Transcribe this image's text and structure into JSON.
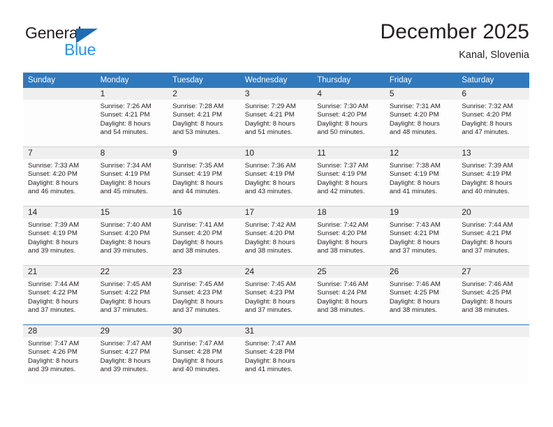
{
  "brand": {
    "name_part1": "General",
    "name_part2": "Blue",
    "triangle_color": "#1f6cb4",
    "blue_color": "#2196f3"
  },
  "header": {
    "month_title": "December 2025",
    "location": "Kanal, Slovenia"
  },
  "theme": {
    "header_row_color": "#3079bc",
    "daynum_band_color": "#efefef",
    "grid_line_color": "#cfcfcf",
    "accent_rule_color": "#2f78bb",
    "text_color": "#231f20"
  },
  "weekdays": [
    "Sunday",
    "Monday",
    "Tuesday",
    "Wednesday",
    "Thursday",
    "Friday",
    "Saturday"
  ],
  "weeks": [
    [
      {
        "day": "",
        "sunrise": "",
        "sunset": "",
        "daylight_line1": "",
        "daylight_line2": "",
        "empty": true
      },
      {
        "day": "1",
        "sunrise": "Sunrise: 7:26 AM",
        "sunset": "Sunset: 4:21 PM",
        "daylight_line1": "Daylight: 8 hours",
        "daylight_line2": "and 54 minutes."
      },
      {
        "day": "2",
        "sunrise": "Sunrise: 7:28 AM",
        "sunset": "Sunset: 4:21 PM",
        "daylight_line1": "Daylight: 8 hours",
        "daylight_line2": "and 53 minutes."
      },
      {
        "day": "3",
        "sunrise": "Sunrise: 7:29 AM",
        "sunset": "Sunset: 4:21 PM",
        "daylight_line1": "Daylight: 8 hours",
        "daylight_line2": "and 51 minutes."
      },
      {
        "day": "4",
        "sunrise": "Sunrise: 7:30 AM",
        "sunset": "Sunset: 4:20 PM",
        "daylight_line1": "Daylight: 8 hours",
        "daylight_line2": "and 50 minutes."
      },
      {
        "day": "5",
        "sunrise": "Sunrise: 7:31 AM",
        "sunset": "Sunset: 4:20 PM",
        "daylight_line1": "Daylight: 8 hours",
        "daylight_line2": "and 48 minutes."
      },
      {
        "day": "6",
        "sunrise": "Sunrise: 7:32 AM",
        "sunset": "Sunset: 4:20 PM",
        "daylight_line1": "Daylight: 8 hours",
        "daylight_line2": "and 47 minutes."
      }
    ],
    [
      {
        "day": "7",
        "sunrise": "Sunrise: 7:33 AM",
        "sunset": "Sunset: 4:20 PM",
        "daylight_line1": "Daylight: 8 hours",
        "daylight_line2": "and 46 minutes."
      },
      {
        "day": "8",
        "sunrise": "Sunrise: 7:34 AM",
        "sunset": "Sunset: 4:19 PM",
        "daylight_line1": "Daylight: 8 hours",
        "daylight_line2": "and 45 minutes."
      },
      {
        "day": "9",
        "sunrise": "Sunrise: 7:35 AM",
        "sunset": "Sunset: 4:19 PM",
        "daylight_line1": "Daylight: 8 hours",
        "daylight_line2": "and 44 minutes."
      },
      {
        "day": "10",
        "sunrise": "Sunrise: 7:36 AM",
        "sunset": "Sunset: 4:19 PM",
        "daylight_line1": "Daylight: 8 hours",
        "daylight_line2": "and 43 minutes."
      },
      {
        "day": "11",
        "sunrise": "Sunrise: 7:37 AM",
        "sunset": "Sunset: 4:19 PM",
        "daylight_line1": "Daylight: 8 hours",
        "daylight_line2": "and 42 minutes."
      },
      {
        "day": "12",
        "sunrise": "Sunrise: 7:38 AM",
        "sunset": "Sunset: 4:19 PM",
        "daylight_line1": "Daylight: 8 hours",
        "daylight_line2": "and 41 minutes."
      },
      {
        "day": "13",
        "sunrise": "Sunrise: 7:39 AM",
        "sunset": "Sunset: 4:19 PM",
        "daylight_line1": "Daylight: 8 hours",
        "daylight_line2": "and 40 minutes."
      }
    ],
    [
      {
        "day": "14",
        "sunrise": "Sunrise: 7:39 AM",
        "sunset": "Sunset: 4:19 PM",
        "daylight_line1": "Daylight: 8 hours",
        "daylight_line2": "and 39 minutes."
      },
      {
        "day": "15",
        "sunrise": "Sunrise: 7:40 AM",
        "sunset": "Sunset: 4:20 PM",
        "daylight_line1": "Daylight: 8 hours",
        "daylight_line2": "and 39 minutes."
      },
      {
        "day": "16",
        "sunrise": "Sunrise: 7:41 AM",
        "sunset": "Sunset: 4:20 PM",
        "daylight_line1": "Daylight: 8 hours",
        "daylight_line2": "and 38 minutes."
      },
      {
        "day": "17",
        "sunrise": "Sunrise: 7:42 AM",
        "sunset": "Sunset: 4:20 PM",
        "daylight_line1": "Daylight: 8 hours",
        "daylight_line2": "and 38 minutes."
      },
      {
        "day": "18",
        "sunrise": "Sunrise: 7:42 AM",
        "sunset": "Sunset: 4:20 PM",
        "daylight_line1": "Daylight: 8 hours",
        "daylight_line2": "and 38 minutes."
      },
      {
        "day": "19",
        "sunrise": "Sunrise: 7:43 AM",
        "sunset": "Sunset: 4:21 PM",
        "daylight_line1": "Daylight: 8 hours",
        "daylight_line2": "and 37 minutes."
      },
      {
        "day": "20",
        "sunrise": "Sunrise: 7:44 AM",
        "sunset": "Sunset: 4:21 PM",
        "daylight_line1": "Daylight: 8 hours",
        "daylight_line2": "and 37 minutes."
      }
    ],
    [
      {
        "day": "21",
        "sunrise": "Sunrise: 7:44 AM",
        "sunset": "Sunset: 4:22 PM",
        "daylight_line1": "Daylight: 8 hours",
        "daylight_line2": "and 37 minutes."
      },
      {
        "day": "22",
        "sunrise": "Sunrise: 7:45 AM",
        "sunset": "Sunset: 4:22 PM",
        "daylight_line1": "Daylight: 8 hours",
        "daylight_line2": "and 37 minutes."
      },
      {
        "day": "23",
        "sunrise": "Sunrise: 7:45 AM",
        "sunset": "Sunset: 4:23 PM",
        "daylight_line1": "Daylight: 8 hours",
        "daylight_line2": "and 37 minutes."
      },
      {
        "day": "24",
        "sunrise": "Sunrise: 7:45 AM",
        "sunset": "Sunset: 4:23 PM",
        "daylight_line1": "Daylight: 8 hours",
        "daylight_line2": "and 37 minutes."
      },
      {
        "day": "25",
        "sunrise": "Sunrise: 7:46 AM",
        "sunset": "Sunset: 4:24 PM",
        "daylight_line1": "Daylight: 8 hours",
        "daylight_line2": "and 38 minutes."
      },
      {
        "day": "26",
        "sunrise": "Sunrise: 7:46 AM",
        "sunset": "Sunset: 4:25 PM",
        "daylight_line1": "Daylight: 8 hours",
        "daylight_line2": "and 38 minutes."
      },
      {
        "day": "27",
        "sunrise": "Sunrise: 7:46 AM",
        "sunset": "Sunset: 4:25 PM",
        "daylight_line1": "Daylight: 8 hours",
        "daylight_line2": "and 38 minutes."
      }
    ],
    [
      {
        "day": "28",
        "sunrise": "Sunrise: 7:47 AM",
        "sunset": "Sunset: 4:26 PM",
        "daylight_line1": "Daylight: 8 hours",
        "daylight_line2": "and 39 minutes."
      },
      {
        "day": "29",
        "sunrise": "Sunrise: 7:47 AM",
        "sunset": "Sunset: 4:27 PM",
        "daylight_line1": "Daylight: 8 hours",
        "daylight_line2": "and 39 minutes."
      },
      {
        "day": "30",
        "sunrise": "Sunrise: 7:47 AM",
        "sunset": "Sunset: 4:28 PM",
        "daylight_line1": "Daylight: 8 hours",
        "daylight_line2": "and 40 minutes."
      },
      {
        "day": "31",
        "sunrise": "Sunrise: 7:47 AM",
        "sunset": "Sunset: 4:28 PM",
        "daylight_line1": "Daylight: 8 hours",
        "daylight_line2": "and 41 minutes."
      },
      {
        "day": "",
        "sunrise": "",
        "sunset": "",
        "daylight_line1": "",
        "daylight_line2": "",
        "empty": true
      },
      {
        "day": "",
        "sunrise": "",
        "sunset": "",
        "daylight_line1": "",
        "daylight_line2": "",
        "empty": true
      },
      {
        "day": "",
        "sunrise": "",
        "sunset": "",
        "daylight_line1": "",
        "daylight_line2": "",
        "empty": true
      }
    ]
  ]
}
